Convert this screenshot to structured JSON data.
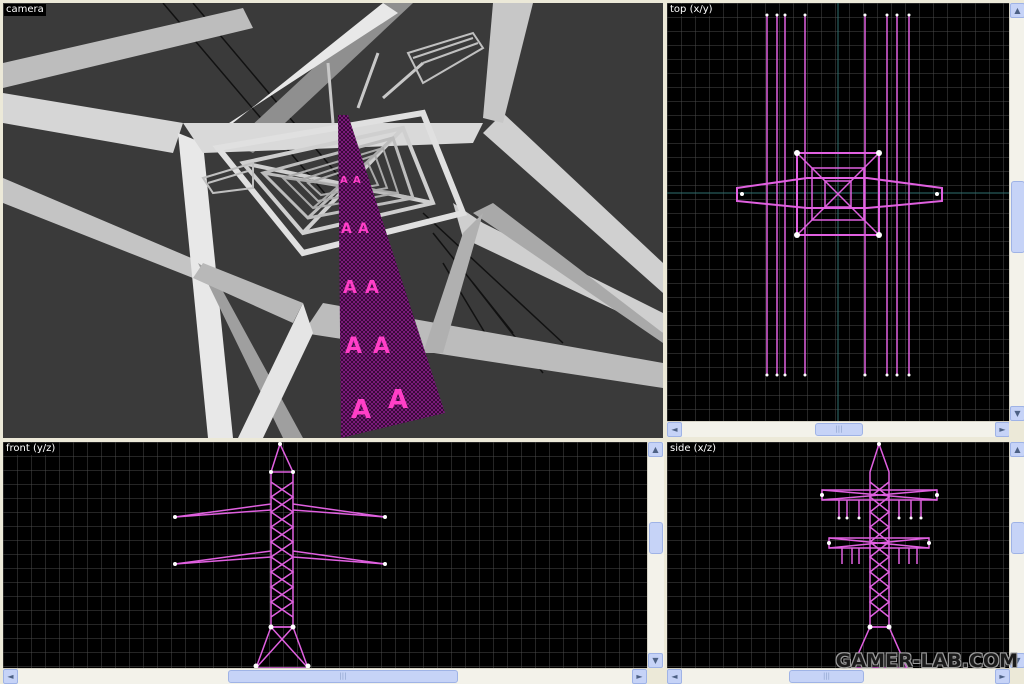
{
  "viewports": {
    "camera": {
      "label": "camera"
    },
    "top": {
      "label": "top (x/y)"
    },
    "front": {
      "label": "front (y/z)"
    },
    "side": {
      "label": "side (x/z)"
    }
  },
  "scroll": {
    "up_arrow": "▲",
    "down_arrow": "▼",
    "left_arrow": "◄",
    "right_arrow": "►",
    "thumb_grip": "|||"
  },
  "watermark": "GAMER-LAB.COM",
  "colors": {
    "background": "#ece9d8",
    "viewport_bg": "#000000",
    "grid": "#4a4a4a",
    "wireframe": "#ff33ff",
    "axis": "#2f6f6f",
    "scrollbar": "#c6d3f7"
  }
}
